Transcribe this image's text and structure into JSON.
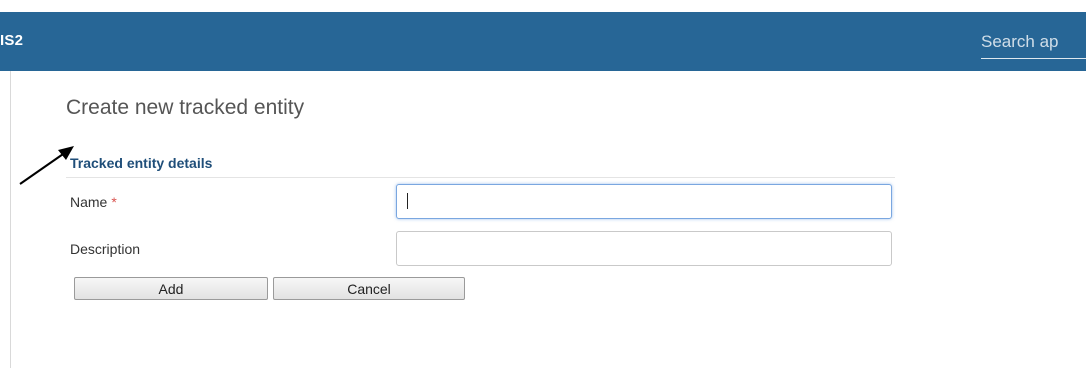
{
  "header": {
    "app_title": "IS2",
    "search_placeholder": "Search ap",
    "background_color": "#276696"
  },
  "page": {
    "title": "Create new tracked entity"
  },
  "form": {
    "section_title": "Tracked entity details",
    "fields": [
      {
        "label": "Name",
        "required_marker": "*",
        "value": "",
        "focused": true
      },
      {
        "label": "Description",
        "value": ""
      }
    ],
    "buttons": {
      "add_label": "Add",
      "cancel_label": "Cancel"
    }
  },
  "colors": {
    "accent": "#276696",
    "section_title": "#1f4e79",
    "required": "#d9534f"
  }
}
